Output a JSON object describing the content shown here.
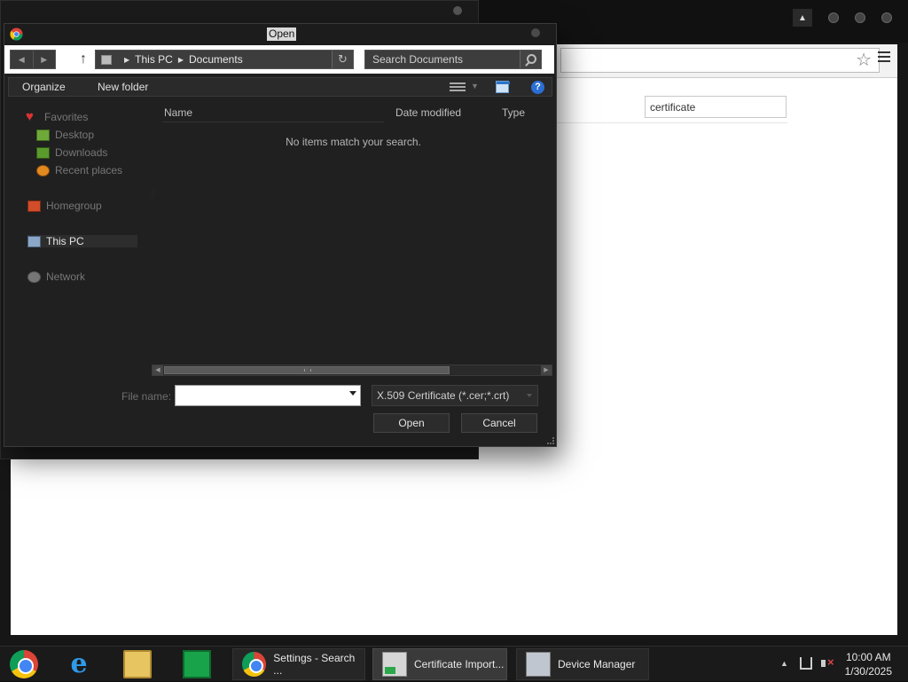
{
  "chrome_window": {
    "settings_search_value": "certificate"
  },
  "open_dialog": {
    "title": "Open",
    "breadcrumb": [
      "This PC",
      "Documents"
    ],
    "search_placeholder": "Search Documents",
    "toolbar": {
      "organize": "Organize",
      "new_folder": "New folder"
    },
    "sidebar": {
      "favorites": "Favorites",
      "desktop": "Desktop",
      "downloads": "Downloads",
      "recent_places": "Recent places",
      "homegroup": "Homegroup",
      "this_pc": "This PC",
      "network": "Network"
    },
    "columns": {
      "name": "Name",
      "date_modified": "Date modified",
      "type": "Type"
    },
    "empty_message": "No items match your search.",
    "file_name_label": "File name:",
    "file_name_value": "",
    "file_type_filter": "X.509 Certificate (*.cer;*.crt)",
    "open_label": "Open",
    "cancel_label": "Cancel"
  },
  "taskbar": {
    "tasks": [
      {
        "label": "Settings - Search ...",
        "icon": "chrome-icon"
      },
      {
        "label": "Certificate Import...",
        "icon": "certificate-icon"
      },
      {
        "label": "Device Manager",
        "icon": "device-manager-icon"
      }
    ],
    "time": "10:00 AM",
    "date": "1/30/2025"
  }
}
